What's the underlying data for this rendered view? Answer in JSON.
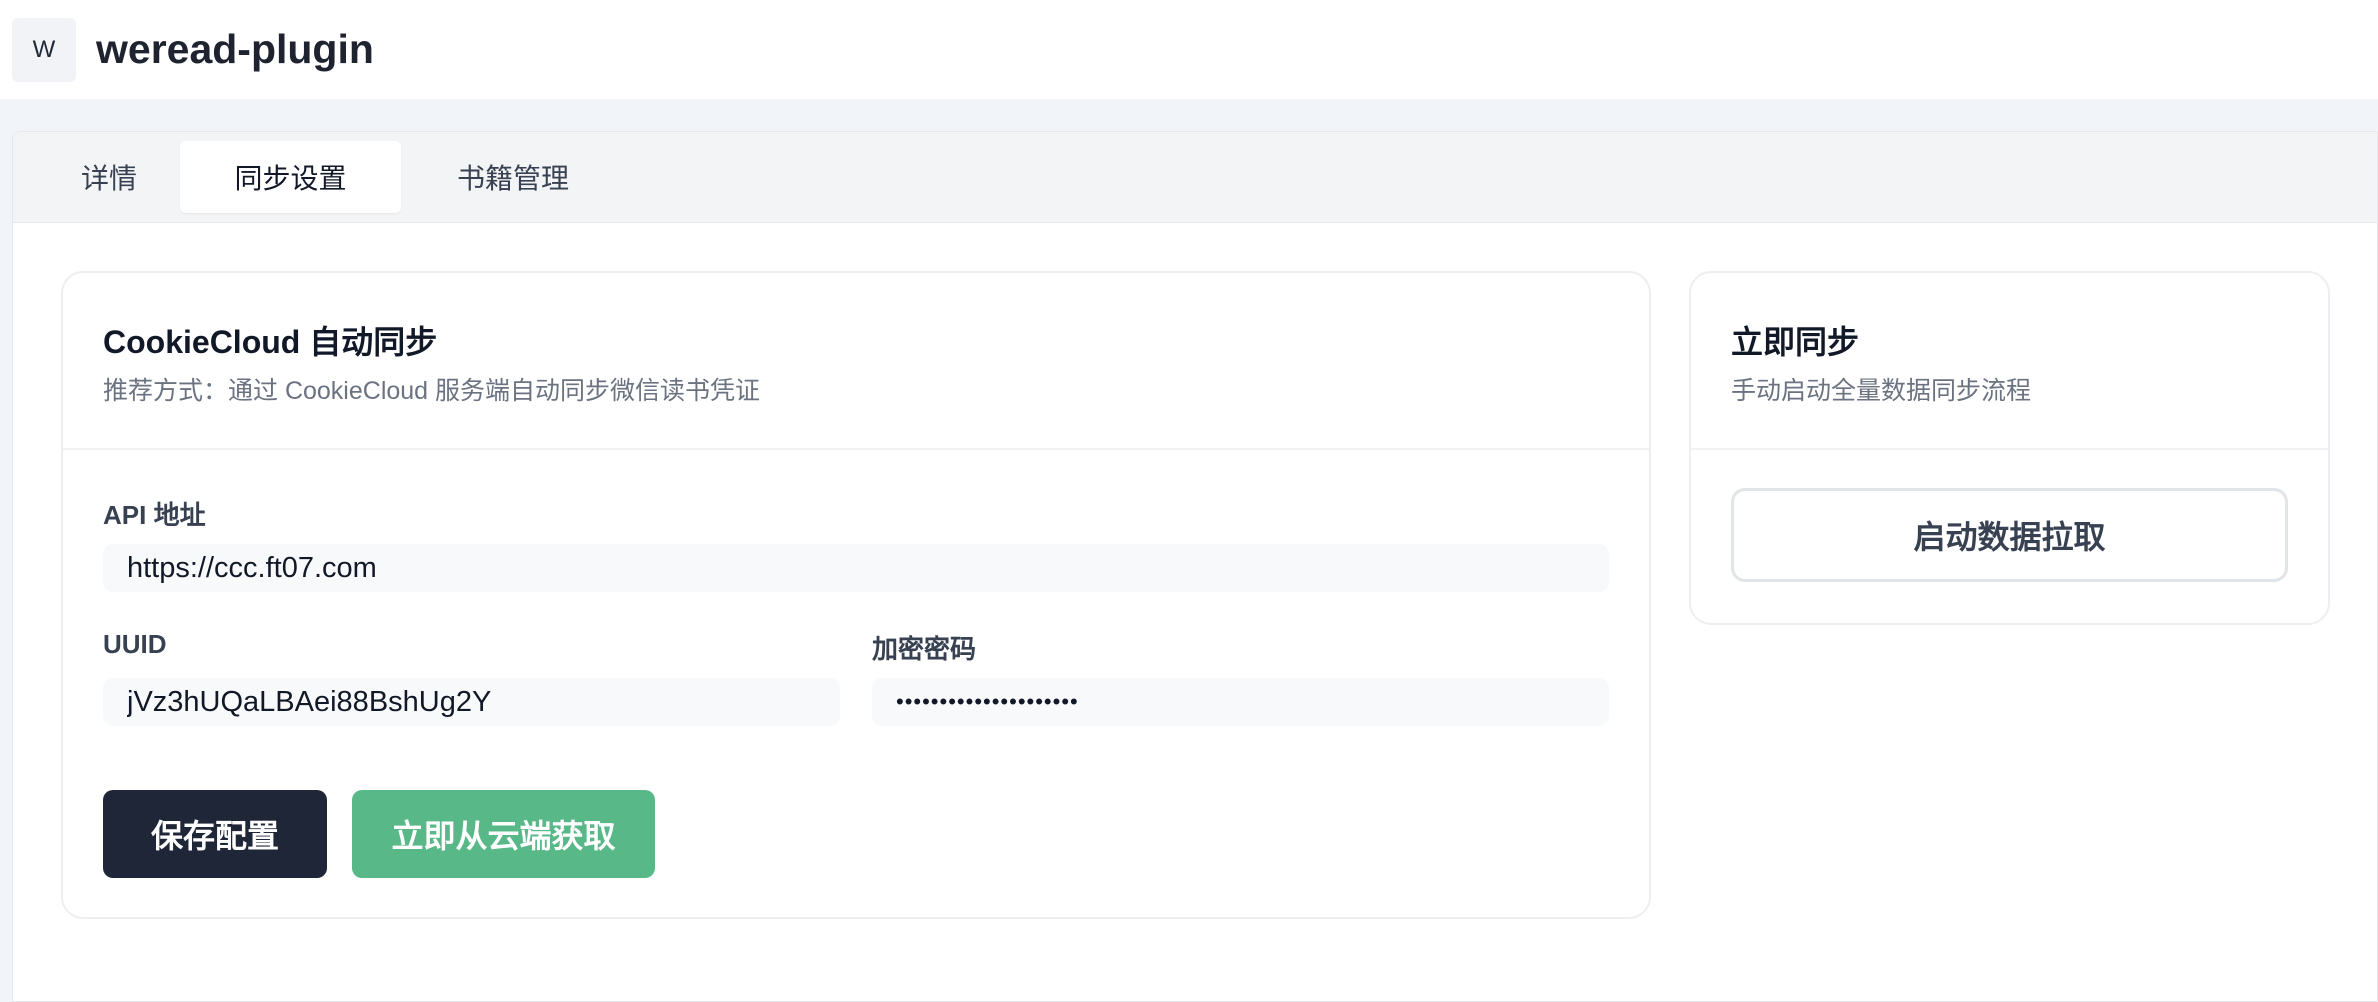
{
  "header": {
    "logo_letter": "W",
    "title": "weread-plugin"
  },
  "tabs": [
    {
      "label": "详情",
      "active": false
    },
    {
      "label": "同步设置",
      "active": true
    },
    {
      "label": "书籍管理",
      "active": false
    }
  ],
  "cookiecloud": {
    "title": "CookieCloud 自动同步",
    "subtitle": "推荐方式：通过 CookieCloud 服务端自动同步微信读书凭证",
    "api_label": "API 地址",
    "api_value": "https://ccc.ft07.com",
    "uuid_label": "UUID",
    "uuid_value": "jVz3hUQaLBAei88BshUg2Y",
    "password_label": "加密密码",
    "password_value": "•••••••••••••••••••••",
    "save_label": "保存配置",
    "fetch_label": "立即从云端获取"
  },
  "sync": {
    "title": "立即同步",
    "subtitle": "手动启动全量数据同步流程",
    "start_label": "启动数据拉取"
  },
  "colors": {
    "primary_dark": "#1f2638",
    "accent_green": "#58b888",
    "page_bg": "#f1f4f8"
  }
}
